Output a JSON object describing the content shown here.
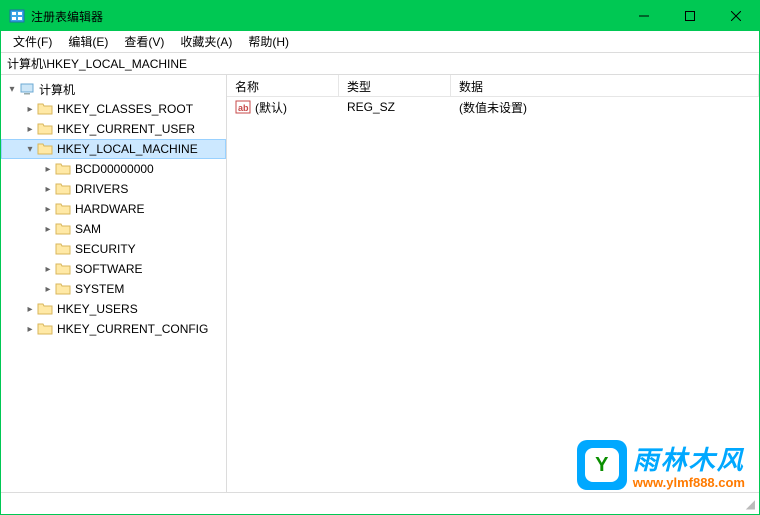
{
  "window": {
    "title": "注册表编辑器"
  },
  "menu": {
    "file": "文件(F)",
    "edit": "编辑(E)",
    "view": "查看(V)",
    "favorites": "收藏夹(A)",
    "help": "帮助(H)"
  },
  "address": {
    "path": "计算机\\HKEY_LOCAL_MACHINE"
  },
  "tree": {
    "root": "计算机",
    "hives": {
      "classes_root": "HKEY_CLASSES_ROOT",
      "current_user": "HKEY_CURRENT_USER",
      "local_machine": "HKEY_LOCAL_MACHINE",
      "users": "HKEY_USERS",
      "current_config": "HKEY_CURRENT_CONFIG"
    },
    "local_machine_children": {
      "bcd": "BCD00000000",
      "drivers": "DRIVERS",
      "hardware": "HARDWARE",
      "sam": "SAM",
      "security": "SECURITY",
      "software": "SOFTWARE",
      "system": "SYSTEM"
    }
  },
  "columns": {
    "name": "名称",
    "type": "类型",
    "data": "数据"
  },
  "values": {
    "default": {
      "name": "(默认)",
      "type": "REG_SZ",
      "data": "(数值未设置)"
    }
  },
  "watermark": {
    "brand": "雨林木风",
    "url": "www.ylmf888.com",
    "glyph": "Y"
  }
}
